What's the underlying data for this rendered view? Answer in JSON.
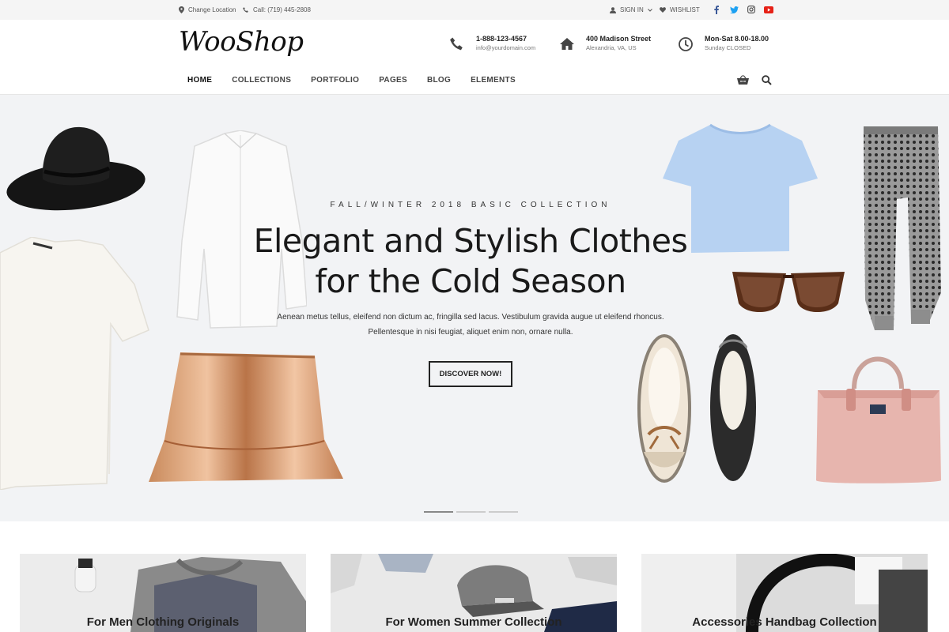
{
  "topbar": {
    "location": "Change Location",
    "call": "Call: (719) 445-2808",
    "signin": "SIGN IN",
    "wishlist": "WISHLIST",
    "social": [
      "facebook-icon",
      "twitter-icon",
      "instagram-icon",
      "youtube-icon"
    ]
  },
  "header": {
    "logo": "WooShop",
    "phone": {
      "line1": "1-888-123-4567",
      "line2": "info@yourdomain.com"
    },
    "address": {
      "line1": "400 Madison Street",
      "line2": "Alexandria, VA, US"
    },
    "hours": {
      "line1": "Mon-Sat 8.00-18.00",
      "line2": "Sunday CLOSED"
    }
  },
  "nav": [
    "HOME",
    "COLLECTIONS",
    "PORTFOLIO",
    "PAGES",
    "BLOG",
    "ELEMENTS"
  ],
  "hero": {
    "kicker": "FALL/WINTER 2018 BASIC COLLECTION",
    "title_line1": "Elegant and Stylish Clothes",
    "title_line2": "for the Cold Season",
    "text_line1": "Aenean metus tellus, eleifend non dictum ac, fringilla sed lacus. Vestibulum gravida augue ut eleifend rhoncus.",
    "text_line2": "Pellentesque in nisi feugiat, aliquet enim non, ornare nulla.",
    "button": "DISCOVER NOW!"
  },
  "cards": [
    {
      "title": "For Men Clothing Originals"
    },
    {
      "title": "For Women Summer Collection"
    },
    {
      "title": "Accessories Handbag Collection"
    }
  ],
  "colors": {
    "facebook": "#3b5998",
    "twitter": "#1da1f2",
    "instagram": "#555555",
    "youtube": "#e62117"
  }
}
